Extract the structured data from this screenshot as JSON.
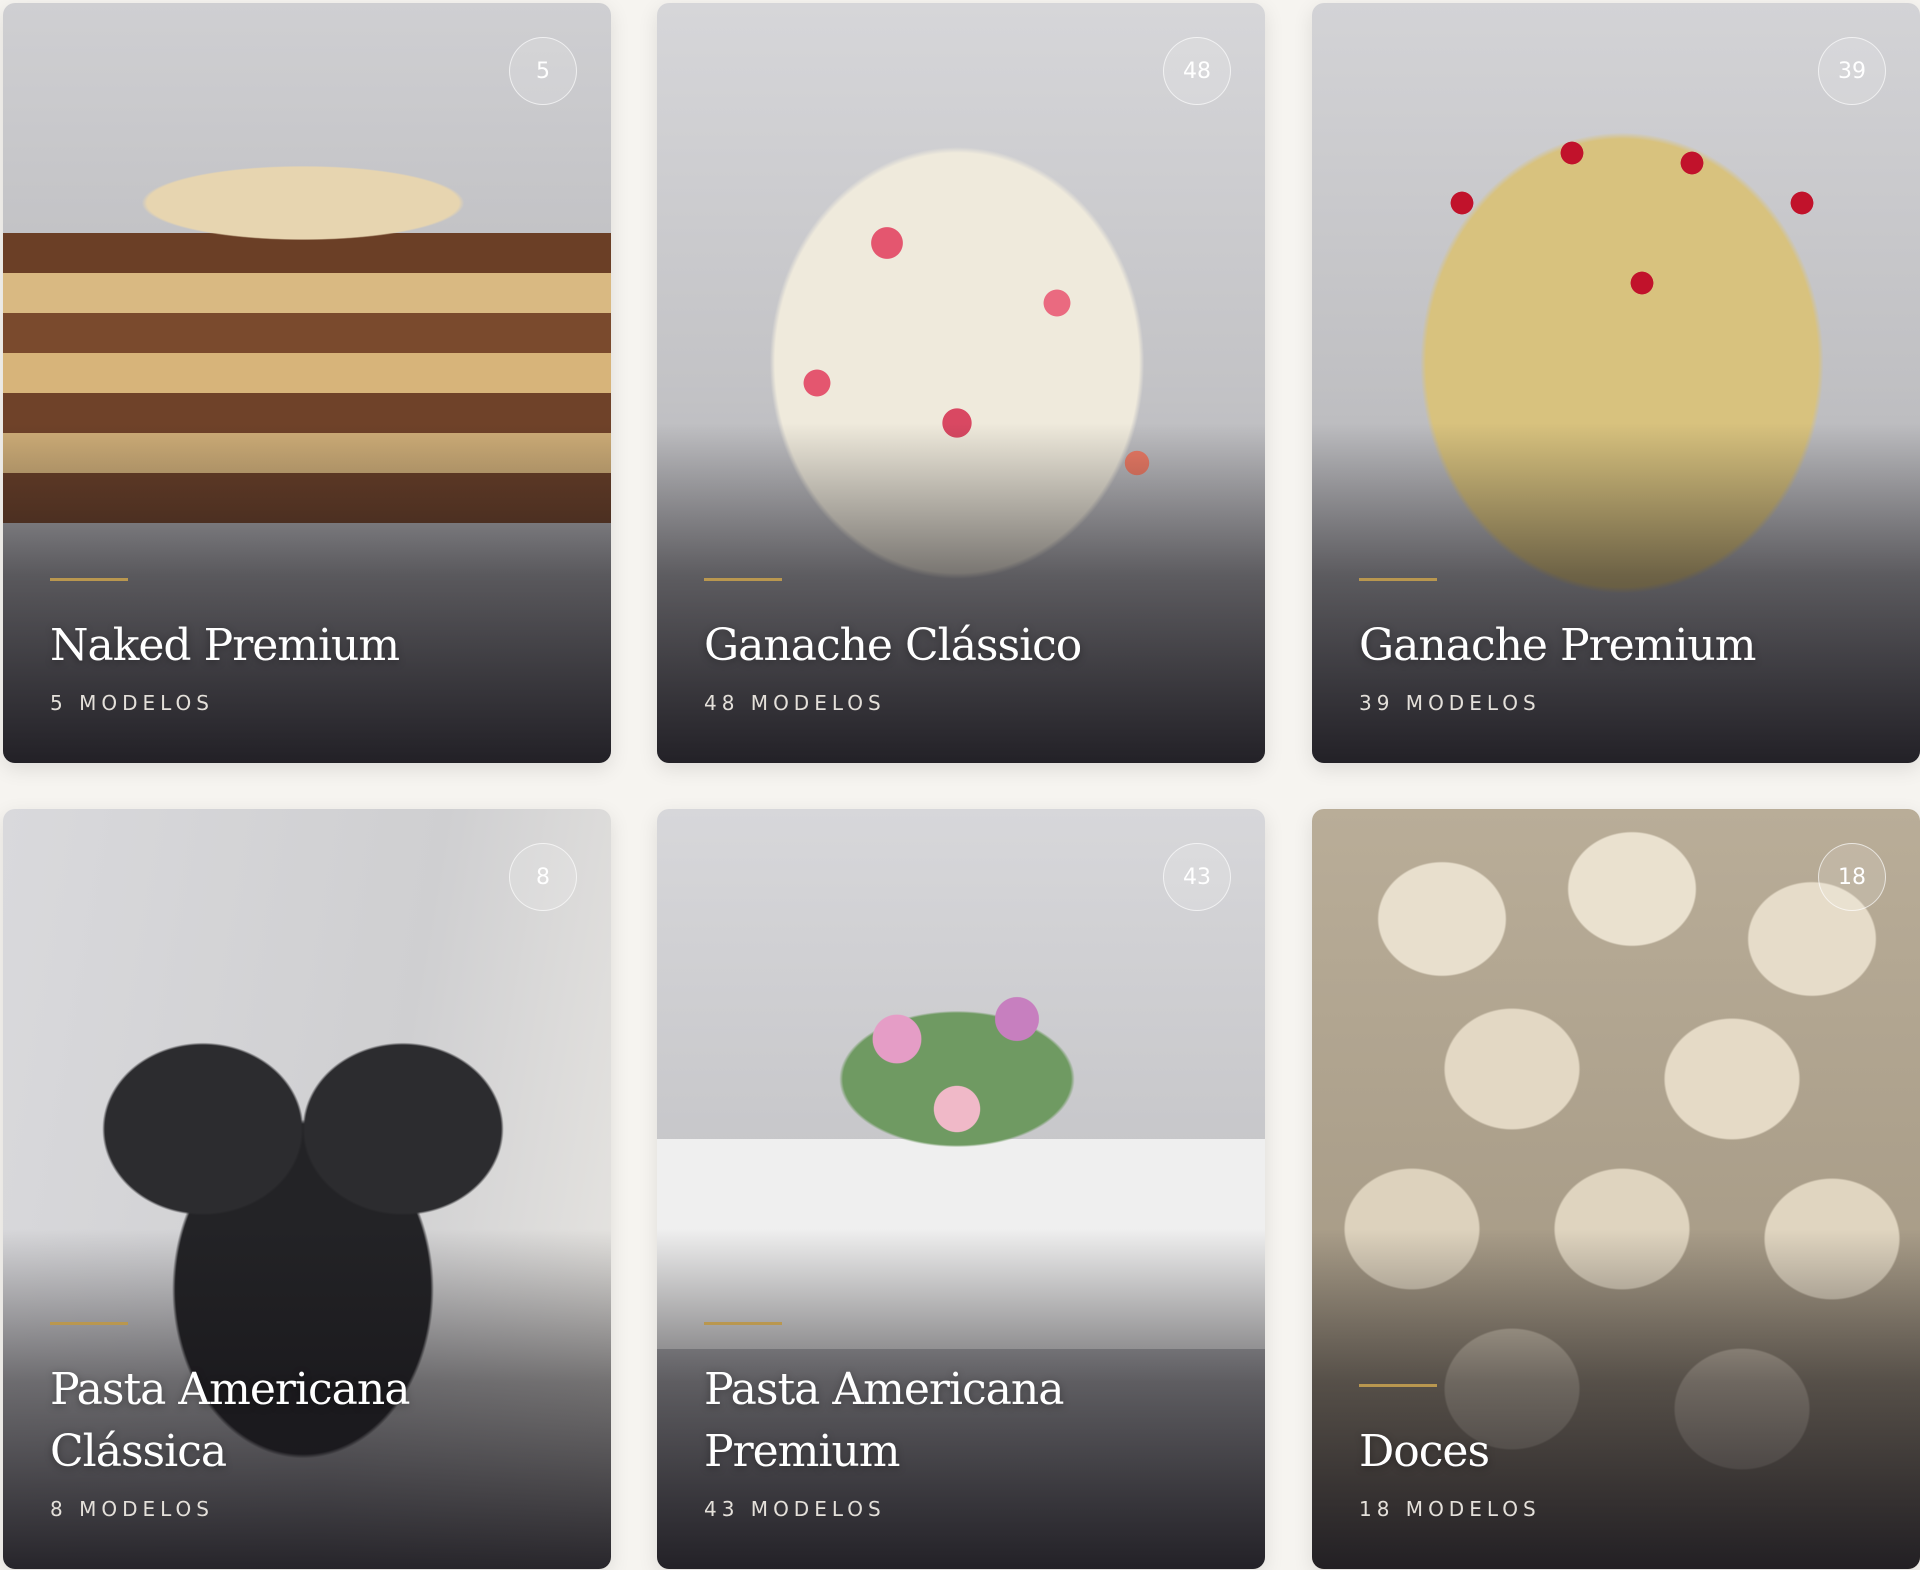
{
  "cards": [
    {
      "title": "Naked Premium",
      "subtitle": "5 MODELOS",
      "count": "5",
      "image": "naked-cake-with-fruit"
    },
    {
      "title": "Ganache Clássico",
      "subtitle": "48 MODELOS",
      "count": "48",
      "image": "floral-painted-cake"
    },
    {
      "title": "Ganache Premium",
      "subtitle": "39 MODELOS",
      "count": "39",
      "image": "heart-cake-with-cherries"
    },
    {
      "title": "Pasta Americana Clássica",
      "subtitle": "8 MODELOS",
      "count": "8",
      "image": "black-bow-cake"
    },
    {
      "title": "Pasta Americana Premium",
      "subtitle": "43 MODELOS",
      "count": "43",
      "image": "white-cake-with-flowers"
    },
    {
      "title": "Doces",
      "subtitle": "18 MODELOS",
      "count": "18",
      "image": "white-chocolate-bonbons"
    }
  ],
  "colors": {
    "accent": "#b9974f",
    "background": "#f6f4f0"
  }
}
